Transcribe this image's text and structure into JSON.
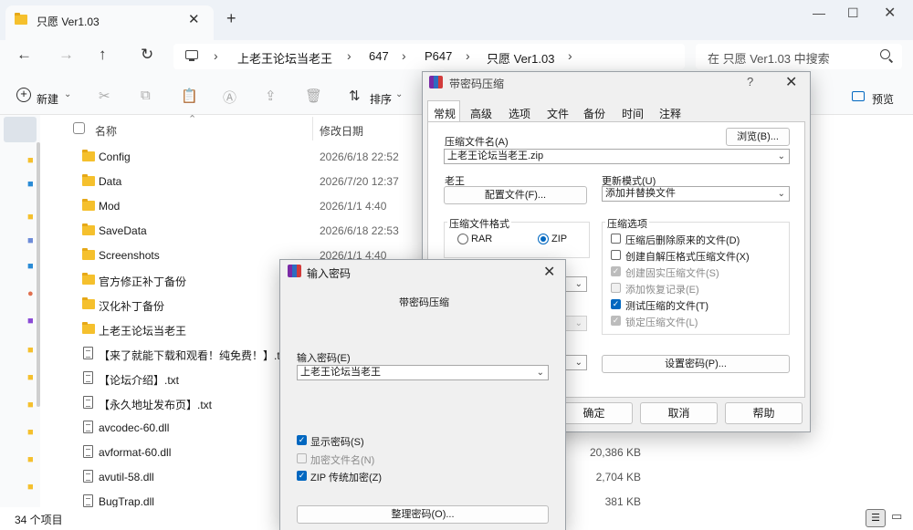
{
  "explorer": {
    "tab_title": "只愿 Ver1.03",
    "tab_close": "✕",
    "new_tab": "+",
    "window_controls": {
      "minimize": "—",
      "maximize": "☐",
      "close": "✕"
    },
    "nav": {
      "back": "←",
      "forward": "→",
      "up": "↑",
      "refresh": "↻"
    },
    "breadcrumb": [
      "上老王论坛当老王",
      "647",
      "P647",
      "只愿 Ver1.03"
    ],
    "breadcrumb_sep": "›",
    "search_placeholder": "在 只愿 Ver1.03 中搜索",
    "toolbar": {
      "new_label": "新建",
      "sort_label": "排序",
      "preview_label": "预览",
      "caret": "⌄",
      "icons": {
        "cut": "✂",
        "copy": "⧉",
        "paste": "📋",
        "rename": "Ⓐ",
        "share": "⇪",
        "delete": "🗑",
        "sort": "⇅"
      }
    },
    "columns": {
      "name": "名称",
      "date": "修改日期",
      "sort_glyph": "⌃"
    },
    "files": [
      {
        "name": "Config",
        "date": "2026/6/18 22:52",
        "type": "folder"
      },
      {
        "name": "Data",
        "date": "2026/7/20 12:37",
        "type": "folder"
      },
      {
        "name": "Mod",
        "date": "2026/1/1 4:40",
        "type": "folder"
      },
      {
        "name": "SaveData",
        "date": "2026/6/18 22:53",
        "type": "folder"
      },
      {
        "name": "Screenshots",
        "date": "2026/1/1 4:40",
        "type": "folder"
      },
      {
        "name": "官方修正补丁备份",
        "date": "",
        "type": "folder"
      },
      {
        "name": "汉化补丁备份",
        "date": "",
        "type": "folder"
      },
      {
        "name": "上老王论坛当老王",
        "date": "",
        "type": "folder"
      },
      {
        "name": "【来了就能下载和观看！纯免费！】.txt",
        "date": "",
        "type": "text"
      },
      {
        "name": "【论坛介绍】.txt",
        "date": "",
        "type": "text"
      },
      {
        "name": "【永久地址发布页】.txt",
        "date": "",
        "type": "text"
      },
      {
        "name": "avcodec-60.dll",
        "date": "",
        "type": "file"
      },
      {
        "name": "avformat-60.dll",
        "date": "",
        "type": "file",
        "size": "20,386 KB"
      },
      {
        "name": "avutil-58.dll",
        "date": "",
        "type": "file",
        "size": "2,704 KB"
      },
      {
        "name": "BugTrap.dll",
        "date": "",
        "type": "file",
        "size": "381 KB"
      }
    ],
    "status_count": "34 个项目"
  },
  "rar_dialog": {
    "title": "带密码压缩",
    "help": "?",
    "close": "✕",
    "tabs": [
      "常规",
      "高级",
      "选项",
      "文件",
      "备份",
      "时间",
      "注释"
    ],
    "archive_name_label": "压缩文件名(A)",
    "browse_button": "浏览(B)...",
    "archive_name_value": "上老王论坛当老王.zip",
    "profile_label": "老王",
    "profile_button": "配置文件(F)...",
    "update_mode_label": "更新模式(U)",
    "update_mode_value": "添加并替换文件",
    "format_group": "压缩文件格式",
    "format_rar": "RAR",
    "format_zip": "ZIP",
    "options_group": "压缩选项",
    "options": [
      {
        "label": "压缩后删除原来的文件(D)",
        "state": "off"
      },
      {
        "label": "创建自解压格式压缩文件(X)",
        "state": "off"
      },
      {
        "label": "创建固实压缩文件(S)",
        "state": "disabled-on"
      },
      {
        "label": "添加恢复记录(E)",
        "state": "disabled"
      },
      {
        "label": "测试压缩的文件(T)",
        "state": "on"
      },
      {
        "label": "锁定压缩文件(L)",
        "state": "disabled-on"
      }
    ],
    "set_password_button": "设置密码(P)...",
    "ok_button": "确定",
    "cancel_button": "取消",
    "help_button": "帮助"
  },
  "password_dialog": {
    "title": "输入密码",
    "close": "✕",
    "heading": "带密码压缩",
    "password_label": "输入密码(E)",
    "password_value": "上老王论坛当老王",
    "checks": [
      {
        "label": "显示密码(S)",
        "state": "on"
      },
      {
        "label": "加密文件名(N)",
        "state": "disabled"
      },
      {
        "label": "ZIP 传统加密(Z)",
        "state": "on"
      }
    ],
    "organize_button": "整理密码(O)..."
  },
  "colors": {
    "accent": "#0067c0",
    "folder": "#f5c02d"
  }
}
